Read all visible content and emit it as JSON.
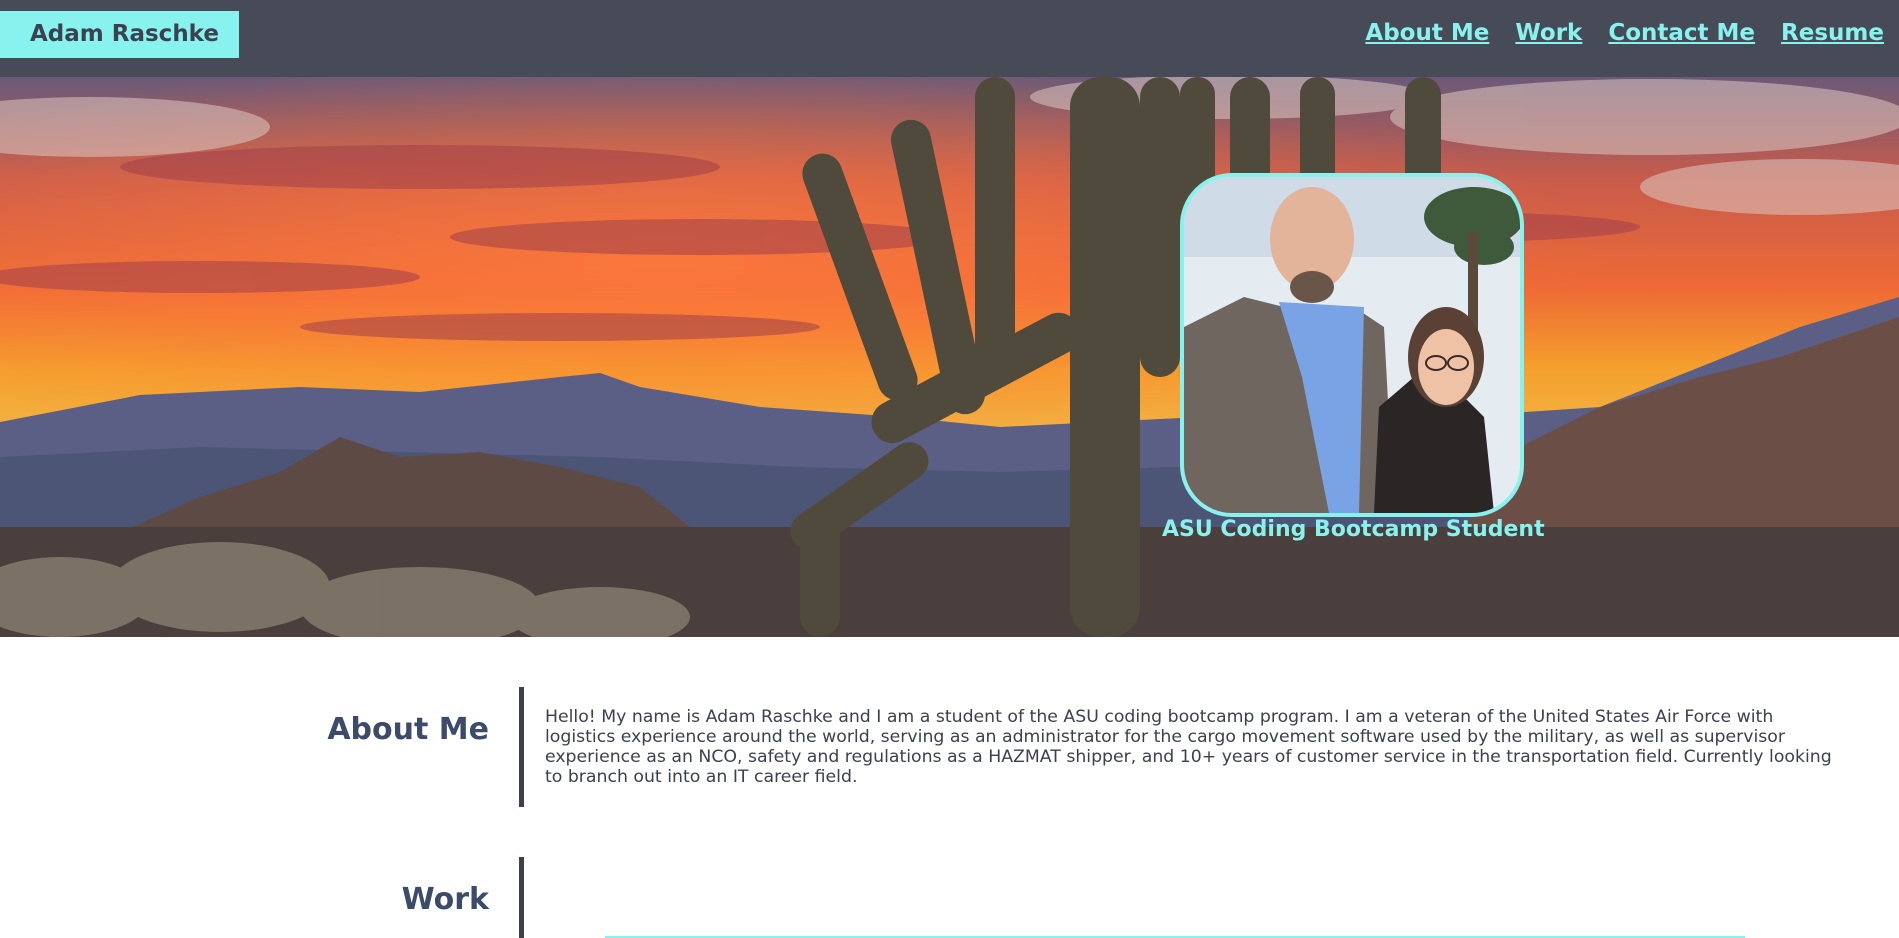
{
  "header": {
    "brand": "Adam Raschke",
    "nav": [
      {
        "label": "About Me"
      },
      {
        "label": "Work"
      },
      {
        "label": "Contact Me"
      },
      {
        "label": "Resume"
      }
    ]
  },
  "hero": {
    "tagline": "ASU Coding Bootcamp Student"
  },
  "about": {
    "title": "About Me",
    "text": "Hello! My name is Adam Raschke and I am a student of the ASU coding bootcamp program. I am a veteran of the United States Air Force with logistics experience around the world, serving as an administrator for the cargo movement software used by the military, as well as supervisor experience as an NCO, safety and regulations as a HAZMAT shipper, and 10+ years of customer service in the transportation field. Currently looking to branch out into an IT career field."
  },
  "work": {
    "title": "Work"
  },
  "colors": {
    "header_bg": "#474a57",
    "accent": "#88f2ee",
    "heading": "#3c4b6a",
    "text": "#3c4150"
  }
}
